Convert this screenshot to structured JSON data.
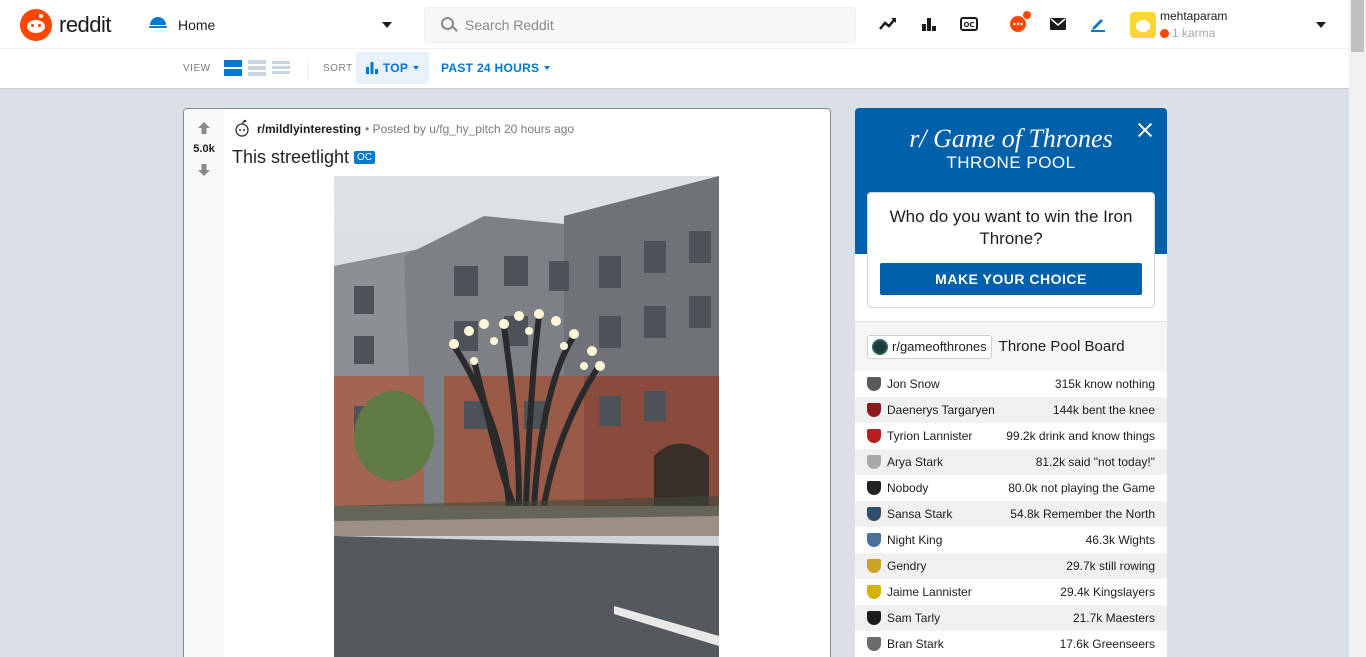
{
  "header": {
    "logo_text": "reddit",
    "home_label": "Home",
    "search_placeholder": "Search Reddit",
    "icons": [
      "trending-icon",
      "stats-icon",
      "oc-icon",
      "chat-icon",
      "mail-icon",
      "pencil-icon"
    ],
    "user": {
      "name": "mehtaparam",
      "karma": "1 karma"
    }
  },
  "subbar": {
    "view_label": "VIEW",
    "sort_label": "SORT",
    "sort_value": "TOP",
    "time_value": "PAST 24 HOURS"
  },
  "post": {
    "votes": "5.0k",
    "subreddit": "r/mildlyinteresting",
    "posted_by": "• Posted by u/fg_hy_pitch 20 hours ago",
    "title": "This streetlight",
    "tag": "OC"
  },
  "widget": {
    "title": "r/ Game of Thrones",
    "subtitle": "THRONE POOL",
    "question": "Who do you want to win the Iron Throne?",
    "cta": "MAKE YOUR CHOICE",
    "subreddit": "r/gameofthrones",
    "board_label": "Throne Pool Board",
    "rows": [
      {
        "name": "Jon Snow",
        "stat": "315k know nothing",
        "color": "#5a5a5a"
      },
      {
        "name": "Daenerys Targaryen",
        "stat": "144k bent the knee",
        "color": "#8b1a1a"
      },
      {
        "name": "Tyrion Lannister",
        "stat": "99.2k drink and know things",
        "color": "#b22222"
      },
      {
        "name": "Arya Stark",
        "stat": "81.2k said \"not today!\"",
        "color": "#a9a9a9"
      },
      {
        "name": "Nobody",
        "stat": "80.0k not playing the Game",
        "color": "#222222"
      },
      {
        "name": "Sansa Stark",
        "stat": "54.8k Remember the North",
        "color": "#2f4f6f"
      },
      {
        "name": "Night King",
        "stat": "46.3k Wights",
        "color": "#4a6f9a"
      },
      {
        "name": "Gendry",
        "stat": "29.7k still rowing",
        "color": "#c9a227"
      },
      {
        "name": "Jaime Lannister",
        "stat": "29.4k Kingslayers",
        "color": "#d4b106"
      },
      {
        "name": "Sam Tarly",
        "stat": "21.7k Maesters",
        "color": "#1c1c1c"
      },
      {
        "name": "Bran Stark",
        "stat": "17.6k Greenseers",
        "color": "#6b6b6b"
      }
    ]
  },
  "colors": {
    "accent": "#0079d3",
    "brand": "#ff4500",
    "widget_blue": "#0060a9"
  }
}
